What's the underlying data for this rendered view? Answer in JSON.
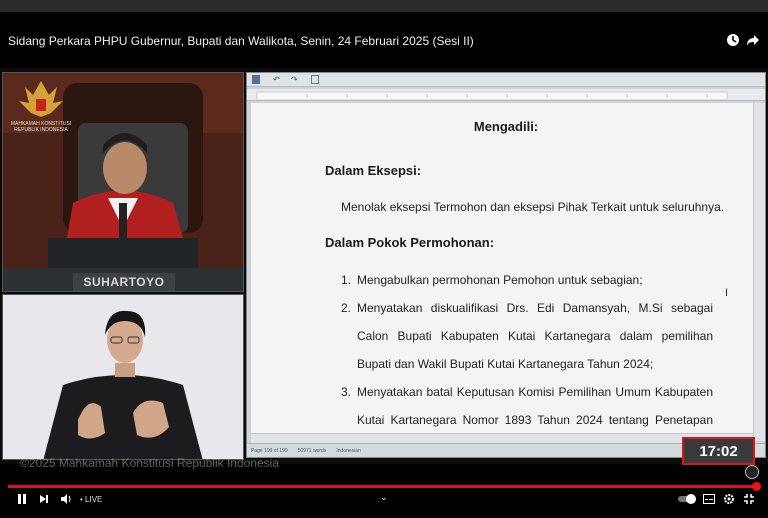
{
  "video": {
    "title": "Sidang Perkara PHPU Gubernur, Bupati dan Walikota, Senin, 24 Februari 2025 (Sesi II)"
  },
  "speaker_cam": {
    "court_logo_text": "MAHKAMAH KONSTITUSI\nREPUBLIK INDONESIA",
    "nameplate": "SUHARTOYO"
  },
  "document": {
    "heading": "Mengadili:",
    "section1_title": "Dalam Eksepsi:",
    "section1_text": "Menolak eksepsi Termohon dan eksepsi Pihak Terkait untuk seluruhnya.",
    "section2_title": "Dalam Pokok Permohonan:",
    "items": [
      {
        "num": "1.",
        "text": "Mengabulkan permohonan Pemohon untuk sebagian;"
      },
      {
        "num": "2.",
        "text": "Menyatakan diskualifikasi Drs. Edi Damansyah, M.Si sebagai Calon Bupati Kabupaten Kutai Kartanegara dalam pemilihan Bupati dan Wakil Bupati Kutai Kartanegara Tahun 2024;"
      },
      {
        "num": "3.",
        "text": "Menyatakan batal Keputusan Komisi Pemilihan Umum Kabupaten Kutai Kartanegara Nomor 1893 Tahun 2024 tentang Penetapan Hasil Pemilihan"
      }
    ],
    "status_bar": {
      "page": "Page 199 of 199",
      "words": "50971 words",
      "language": "Indonesian"
    }
  },
  "overlay": {
    "timer": "17:02",
    "watermark": "©2025 Mahkamah Konstitusi Republik Indonesia"
  },
  "player": {
    "live_label": "• LIVE",
    "progress_fraction": 0.98
  },
  "colors": {
    "progress": "#d8112a",
    "timer_border": "#d3191c"
  }
}
